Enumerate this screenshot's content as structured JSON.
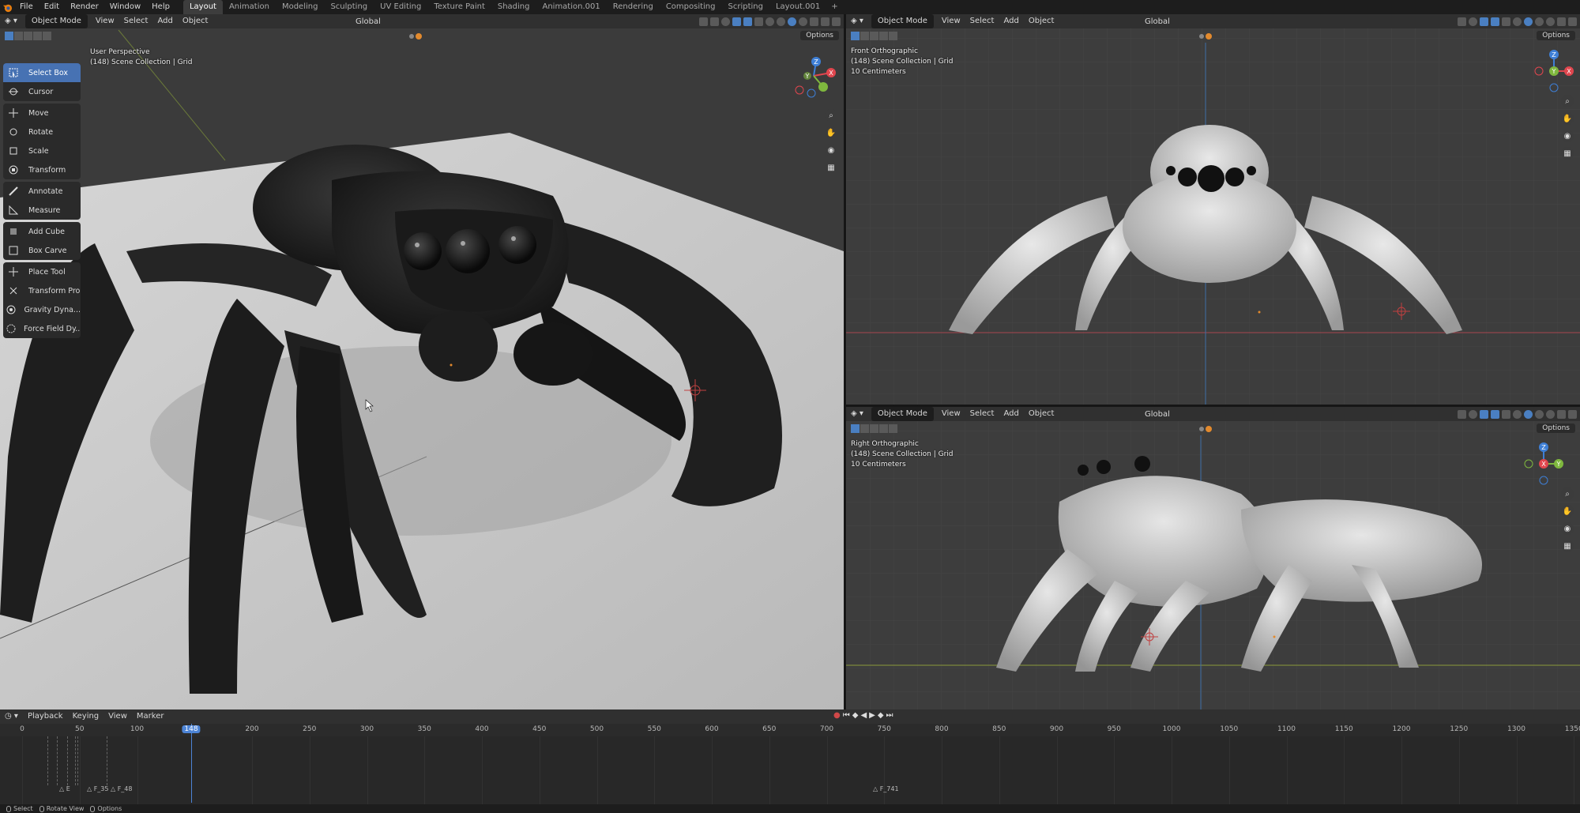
{
  "menu": [
    "File",
    "Edit",
    "Render",
    "Window",
    "Help"
  ],
  "workspaces": [
    "Layout",
    "Animation",
    "Modeling",
    "Sculpting",
    "UV Editing",
    "Texture Paint",
    "Shading",
    "Animation.001",
    "Rendering",
    "Compositing",
    "Scripting",
    "Layout.001"
  ],
  "workspace_add": "+",
  "viewport_header": {
    "mode": "Object Mode",
    "menus": [
      "View",
      "Select",
      "Add",
      "Object"
    ],
    "transform_orientation": "Global",
    "options": "Options"
  },
  "viewports": {
    "main": {
      "view_name": "User Perspective",
      "collection": "(148) Scene Collection | Grid"
    },
    "front": {
      "view_name": "Front Orthographic",
      "collection": "(148) Scene Collection | Grid",
      "scale": "10 Centimeters"
    },
    "right": {
      "view_name": "Right Orthographic",
      "collection": "(148) Scene Collection | Grid",
      "scale": "10 Centimeters"
    }
  },
  "toolbar": [
    {
      "label": "Select Box",
      "icon": "select-box-icon",
      "active": true
    },
    {
      "label": "Cursor",
      "icon": "cursor-icon"
    },
    {
      "label": "Move",
      "icon": "move-icon"
    },
    {
      "label": "Rotate",
      "icon": "rotate-icon"
    },
    {
      "label": "Scale",
      "icon": "scale-icon"
    },
    {
      "label": "Transform",
      "icon": "transform-icon"
    },
    {
      "label": "Annotate",
      "icon": "annotate-icon"
    },
    {
      "label": "Measure",
      "icon": "measure-icon"
    },
    {
      "label": "Add Cube",
      "icon": "add-cube-icon"
    },
    {
      "label": "Box Carve",
      "icon": "box-carve-icon"
    },
    {
      "label": "Place Tool",
      "icon": "place-tool-icon"
    },
    {
      "label": "Transform Pro",
      "icon": "transform-pro-icon"
    },
    {
      "label": "Gravity Dyna...",
      "icon": "gravity-icon"
    },
    {
      "label": "Force Field Dy...",
      "icon": "force-field-icon"
    }
  ],
  "gizmo_axes": {
    "x": "X",
    "y": "Y",
    "z": "Z"
  },
  "timeline": {
    "menus": [
      "Playback",
      "Keying",
      "View",
      "Marker"
    ],
    "current_frame": "148",
    "ticks": [
      "0",
      "50",
      "100",
      "200",
      "250",
      "300",
      "350",
      "400",
      "450",
      "500",
      "550",
      "600",
      "650",
      "700",
      "750",
      "800",
      "850",
      "900",
      "950",
      "1000",
      "1050",
      "1100",
      "1150",
      "1200",
      "1250",
      "1300",
      "1350"
    ],
    "markers": [
      "E",
      "F_35",
      "F_48",
      "F_741"
    ]
  },
  "statusbar": [
    "Select",
    "Rotate View",
    "Options"
  ],
  "colors": {
    "accent": "#4772b3",
    "axis_x": "#e0464e",
    "axis_y": "#7fb83e",
    "axis_z": "#3e7fd6",
    "playhead": "#4d84d6"
  }
}
